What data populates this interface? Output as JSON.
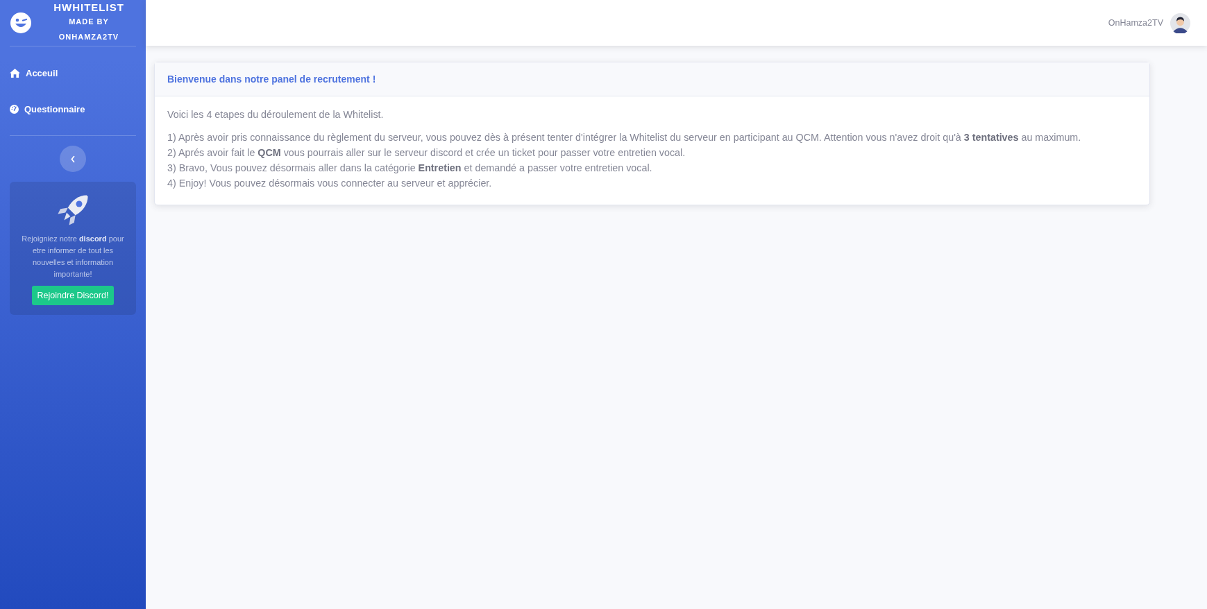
{
  "brand": {
    "title": "HWHITELIST",
    "subtitle": "MADE BY",
    "author": "ONHAMZA2TV"
  },
  "nav": [
    {
      "label": "Acceuil",
      "kind": "home"
    },
    {
      "label": "Questionnaire",
      "kind": "gauge"
    }
  ],
  "promo": {
    "text": "Rejoigniez notre **discord** pour etre informer de tout les nouvelles et information importante!",
    "button": "Rejoindre Discord!"
  },
  "topbar": {
    "username": "OnHamza2TV"
  },
  "card": {
    "title": "Bienvenue dans notre panel de recrutement !",
    "intro": "Voici les 4 etapes du déroulement de la Whitelist.",
    "steps": [
      "1) Après avoir pris connaissance du règlement du serveur, vous pouvez dès à présent tenter d'intégrer la Whitelist du serveur en participant au QCM. Attention vous n'avez droit qu'à **3 tentatives** au maximum.",
      "2) Aprés avoir fait le **QCM** vous pourrais aller sur le serveur discord et crée un ticket pour passer votre entretien vocal.",
      "3) Bravo, Vous pouvez désormais aller dans la catégorie **Entretien** et demandé a passer votre entretien vocal.",
      "4) Enjoy! Vous pouvez désormais vous connecter au serveur et apprécier."
    ]
  }
}
